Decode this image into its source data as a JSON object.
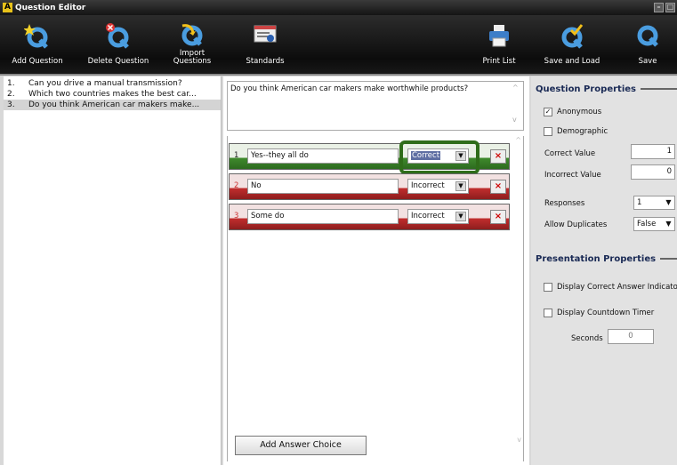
{
  "window": {
    "title": "Question Editor",
    "logo": "A"
  },
  "toolbar": {
    "add_question": "Add Question",
    "delete_question": "Delete Question",
    "import_questions_1": "Import",
    "import_questions_2": "Questions",
    "standards": "Standards",
    "print_list": "Print List",
    "save_and_load": "Save and Load",
    "save": "Save"
  },
  "questions": [
    {
      "num": "1.",
      "text": "Can you drive a manual transmission?"
    },
    {
      "num": "2.",
      "text": "Which two countries makes the best car..."
    },
    {
      "num": "3.",
      "text": "Do you think American car makers make..."
    }
  ],
  "editor": {
    "question_text": "Do you think American car makers make worthwhile products?",
    "add_answer_label": "Add Answer Choice",
    "answers": [
      {
        "num": "1",
        "text": "Yes--they all do",
        "status": "Correct"
      },
      {
        "num": "2",
        "text": "No",
        "status": "Incorrect"
      },
      {
        "num": "3",
        "text": "Some do",
        "status": "Incorrect"
      }
    ]
  },
  "properties": {
    "question_header": "Question Properties",
    "anonymous": "Anonymous",
    "anonymous_checked": true,
    "demographic": "Demographic",
    "correct_value_label": "Correct Value",
    "correct_value": "1",
    "incorrect_value_label": "Incorrect Value",
    "incorrect_value": "0",
    "responses_label": "Responses",
    "responses": "1",
    "allow_duplicates_label": "Allow Duplicates",
    "allow_duplicates": "False",
    "presentation_header": "Presentation Properties",
    "display_correct": "Display Correct Answer Indicator",
    "display_countdown": "Display Countdown Timer",
    "seconds_label": "Seconds",
    "seconds": "0"
  },
  "colors": {
    "correct": "#3f8a2c",
    "incorrect": "#c22e2e",
    "highlight": "#2f6d1a"
  }
}
